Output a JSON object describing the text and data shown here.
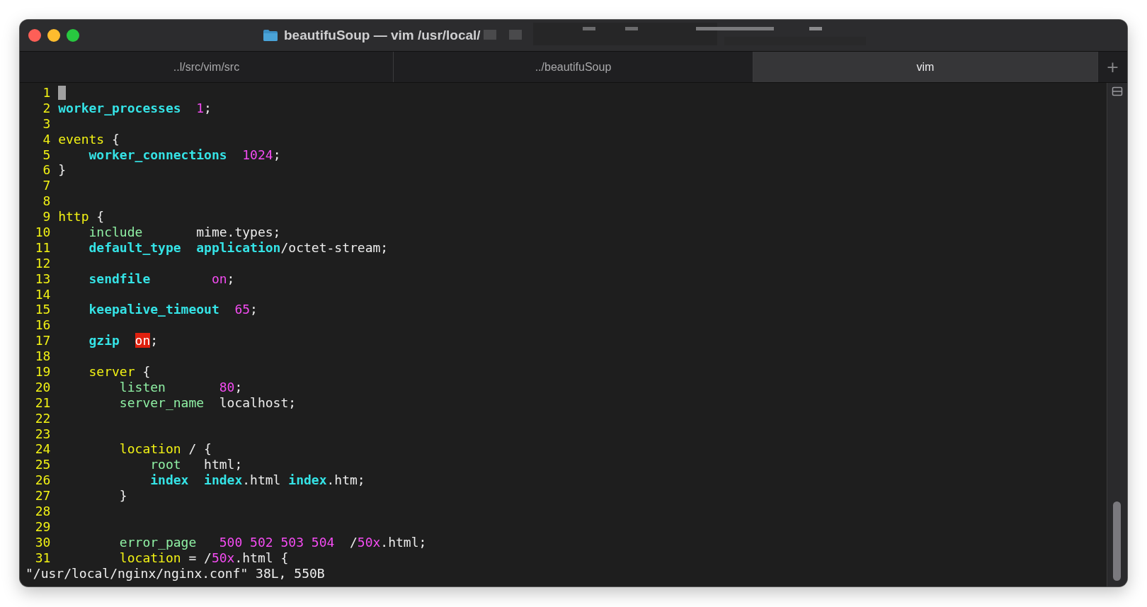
{
  "window": {
    "title": "beautifuSoup — vim /usr/local/"
  },
  "tabs": [
    {
      "label": "..l/src/vim/src",
      "selected": false
    },
    {
      "label": "../beautifuSoup",
      "selected": false
    },
    {
      "label": "vim",
      "selected": true
    }
  ],
  "new_tab_button": "+",
  "editor": {
    "lines": [
      {
        "number": "1",
        "cursor": true
      },
      {
        "number": "2",
        "cursor": false,
        "segments": [
          {
            "kind": "keyword",
            "text": "worker_processes"
          },
          {
            "kind": "number",
            "text": "  1"
          },
          {
            "kind": "text",
            "text": ";"
          }
        ]
      },
      {
        "number": "3",
        "cursor": false
      },
      {
        "number": "4",
        "cursor": false,
        "segments": [
          {
            "kind": "block",
            "text": "events"
          },
          {
            "kind": "text",
            "text": " {"
          }
        ]
      },
      {
        "number": "5",
        "cursor": false,
        "segments": [
          {
            "kind": "keyword",
            "text": "    worker_connections"
          },
          {
            "kind": "number",
            "text": "  1024"
          },
          {
            "kind": "text",
            "text": ";"
          }
        ]
      },
      {
        "number": "6",
        "cursor": false,
        "segments": [
          {
            "kind": "text",
            "text": "}"
          }
        ]
      },
      {
        "number": "7",
        "cursor": false
      },
      {
        "number": "8",
        "cursor": false
      },
      {
        "number": "9",
        "cursor": false,
        "segments": [
          {
            "kind": "block",
            "text": "http"
          },
          {
            "kind": "text",
            "text": " {"
          }
        ]
      },
      {
        "number": "10",
        "cursor": false,
        "segments": [
          {
            "kind": "directive",
            "text": "    include"
          },
          {
            "kind": "text",
            "text": "       mime.types;"
          }
        ]
      },
      {
        "number": "11",
        "cursor": false,
        "segments": [
          {
            "kind": "keyword",
            "text": "    default_type"
          },
          {
            "kind": "keyword",
            "text": "  application"
          },
          {
            "kind": "text",
            "text": "/octet-stream;"
          }
        ]
      },
      {
        "number": "12",
        "cursor": false
      },
      {
        "number": "13",
        "cursor": false,
        "segments": [
          {
            "kind": "keyword",
            "text": "    sendfile"
          },
          {
            "kind": "number",
            "text": "        on"
          },
          {
            "kind": "text",
            "text": ";"
          }
        ]
      },
      {
        "number": "14",
        "cursor": false
      },
      {
        "number": "15",
        "cursor": false,
        "segments": [
          {
            "kind": "keyword",
            "text": "    keepalive_timeout"
          },
          {
            "kind": "number",
            "text": "  65"
          },
          {
            "kind": "text",
            "text": ";"
          }
        ]
      },
      {
        "number": "16",
        "cursor": false
      },
      {
        "number": "17",
        "cursor": false,
        "segments": [
          {
            "kind": "keyword",
            "text": "    gzip"
          },
          {
            "kind": "error",
            "text": "on"
          },
          {
            "kind": "text",
            "text": ";"
          }
        ]
      },
      {
        "number": "18",
        "cursor": false
      },
      {
        "number": "19",
        "cursor": false,
        "segments": [
          {
            "kind": "block",
            "text": "    server"
          },
          {
            "kind": "text",
            "text": " {"
          }
        ]
      },
      {
        "number": "20",
        "cursor": false,
        "segments": [
          {
            "kind": "directive",
            "text": "        listen"
          },
          {
            "kind": "number",
            "text": "       80"
          },
          {
            "kind": "text",
            "text": ";"
          }
        ]
      },
      {
        "number": "21",
        "cursor": false,
        "segments": [
          {
            "kind": "directive",
            "text": "        server_name"
          },
          {
            "kind": "text",
            "text": "  localhost;"
          }
        ]
      },
      {
        "number": "22",
        "cursor": false
      },
      {
        "number": "23",
        "cursor": false
      },
      {
        "number": "24",
        "cursor": false,
        "segments": [
          {
            "kind": "block",
            "text": "        location"
          },
          {
            "kind": "text",
            "text": " / {"
          }
        ]
      },
      {
        "number": "25",
        "cursor": false,
        "segments": [
          {
            "kind": "directive",
            "text": "            root"
          },
          {
            "kind": "text",
            "text": "   html;"
          }
        ]
      },
      {
        "number": "26",
        "cursor": false,
        "segments": [
          {
            "kind": "keyword",
            "text": "            index"
          },
          {
            "kind": "keyword",
            "text": "  index"
          },
          {
            "kind": "text",
            "text": ".html "
          },
          {
            "kind": "keyword",
            "text": "index"
          },
          {
            "kind": "text",
            "text": ".htm;"
          }
        ]
      },
      {
        "number": "27",
        "cursor": false,
        "segments": [
          {
            "kind": "text",
            "text": "        }"
          }
        ]
      },
      {
        "number": "28",
        "cursor": false
      },
      {
        "number": "29",
        "cursor": false
      },
      {
        "number": "30",
        "cursor": false,
        "segments": [
          {
            "kind": "directive",
            "text": "        error_page"
          },
          {
            "kind": "number",
            "text": "   500 502 503 504"
          },
          {
            "kind": "text",
            "text": "  /"
          },
          {
            "kind": "number",
            "text": "50x"
          },
          {
            "kind": "text",
            "text": ".html;"
          }
        ]
      },
      {
        "number": "31",
        "cursor": false,
        "segments": [
          {
            "kind": "block",
            "text": "        location"
          },
          {
            "kind": "text",
            "text": " = /"
          },
          {
            "kind": "number",
            "text": "50x"
          },
          {
            "kind": "text",
            "text": ".html {"
          }
        ]
      }
    ],
    "status_line": "\"/usr/local/nginx/nginx.conf\" 38L, 550B"
  }
}
